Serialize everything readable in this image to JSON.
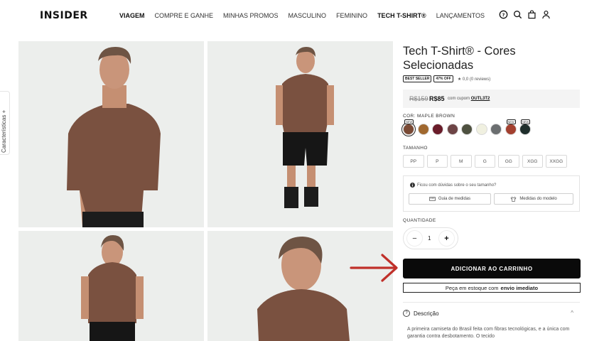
{
  "header": {
    "logo": "INSIDER",
    "nav": [
      {
        "label": "VIAGEM",
        "bold": true
      },
      {
        "label": "COMPRE E GANHE",
        "bold": false
      },
      {
        "label": "MINHAS PROMOS",
        "bold": false
      },
      {
        "label": "MASCULINO",
        "bold": false
      },
      {
        "label": "FEMININO",
        "bold": false
      },
      {
        "label": "TECH T-SHIRT®",
        "bold": true
      },
      {
        "label": "LANÇAMENTOS",
        "bold": false
      }
    ],
    "icons": [
      "help-icon",
      "search-icon",
      "bag-icon",
      "user-icon"
    ]
  },
  "side_tab": {
    "label": "Características +"
  },
  "product": {
    "title": "Tech T-Shirt® - Cores Selecionadas",
    "badges": [
      "BEST SELLER",
      "47% OFF"
    ],
    "rating": "★ 0,0 (0 reviews)",
    "price_old": "R$159",
    "price_new": "R$85",
    "coupon_text": "com cupom",
    "coupon_code": "OUTL3T2",
    "color_label": "COR: MAPLE BROWN",
    "colors": [
      {
        "hex": "#7a4a35",
        "new": true,
        "selected": true
      },
      {
        "hex": "#a0682f",
        "new": false,
        "selected": false
      },
      {
        "hex": "#6a1c2a",
        "new": false,
        "selected": false
      },
      {
        "hex": "#6d4446",
        "new": false,
        "selected": false
      },
      {
        "hex": "#4e5140",
        "new": false,
        "selected": false
      },
      {
        "hex": "#f0f0e0",
        "new": false,
        "selected": false
      },
      {
        "hex": "#6b6e70",
        "new": false,
        "selected": false
      },
      {
        "hex": "#a3402f",
        "new": true,
        "selected": false
      },
      {
        "hex": "#1f2e2b",
        "new": true,
        "selected": false
      }
    ],
    "new_badge": "NEW",
    "size_label": "TAMANHO",
    "sizes": [
      "PP",
      "P",
      "M",
      "G",
      "GG",
      "XGG",
      "XXGG"
    ],
    "doubt_text": "Ficou com dúvidas sobre o seu tamanho?",
    "size_guide": "Guia de medidas",
    "model_measures": "Medidas do modelo",
    "qty_label": "QUANTIDADE",
    "qty_value": "1",
    "add_to_cart": "ADICIONAR AO CARRINHO",
    "stock_prefix": "Peça em estoque com",
    "stock_bold": "envio imediato",
    "desc_title": "Descrição",
    "desc_text": "A primeira camiseta do Brasil feita com fibras tecnológicas, e a única com garantia contra desbotamento. O tecido"
  }
}
